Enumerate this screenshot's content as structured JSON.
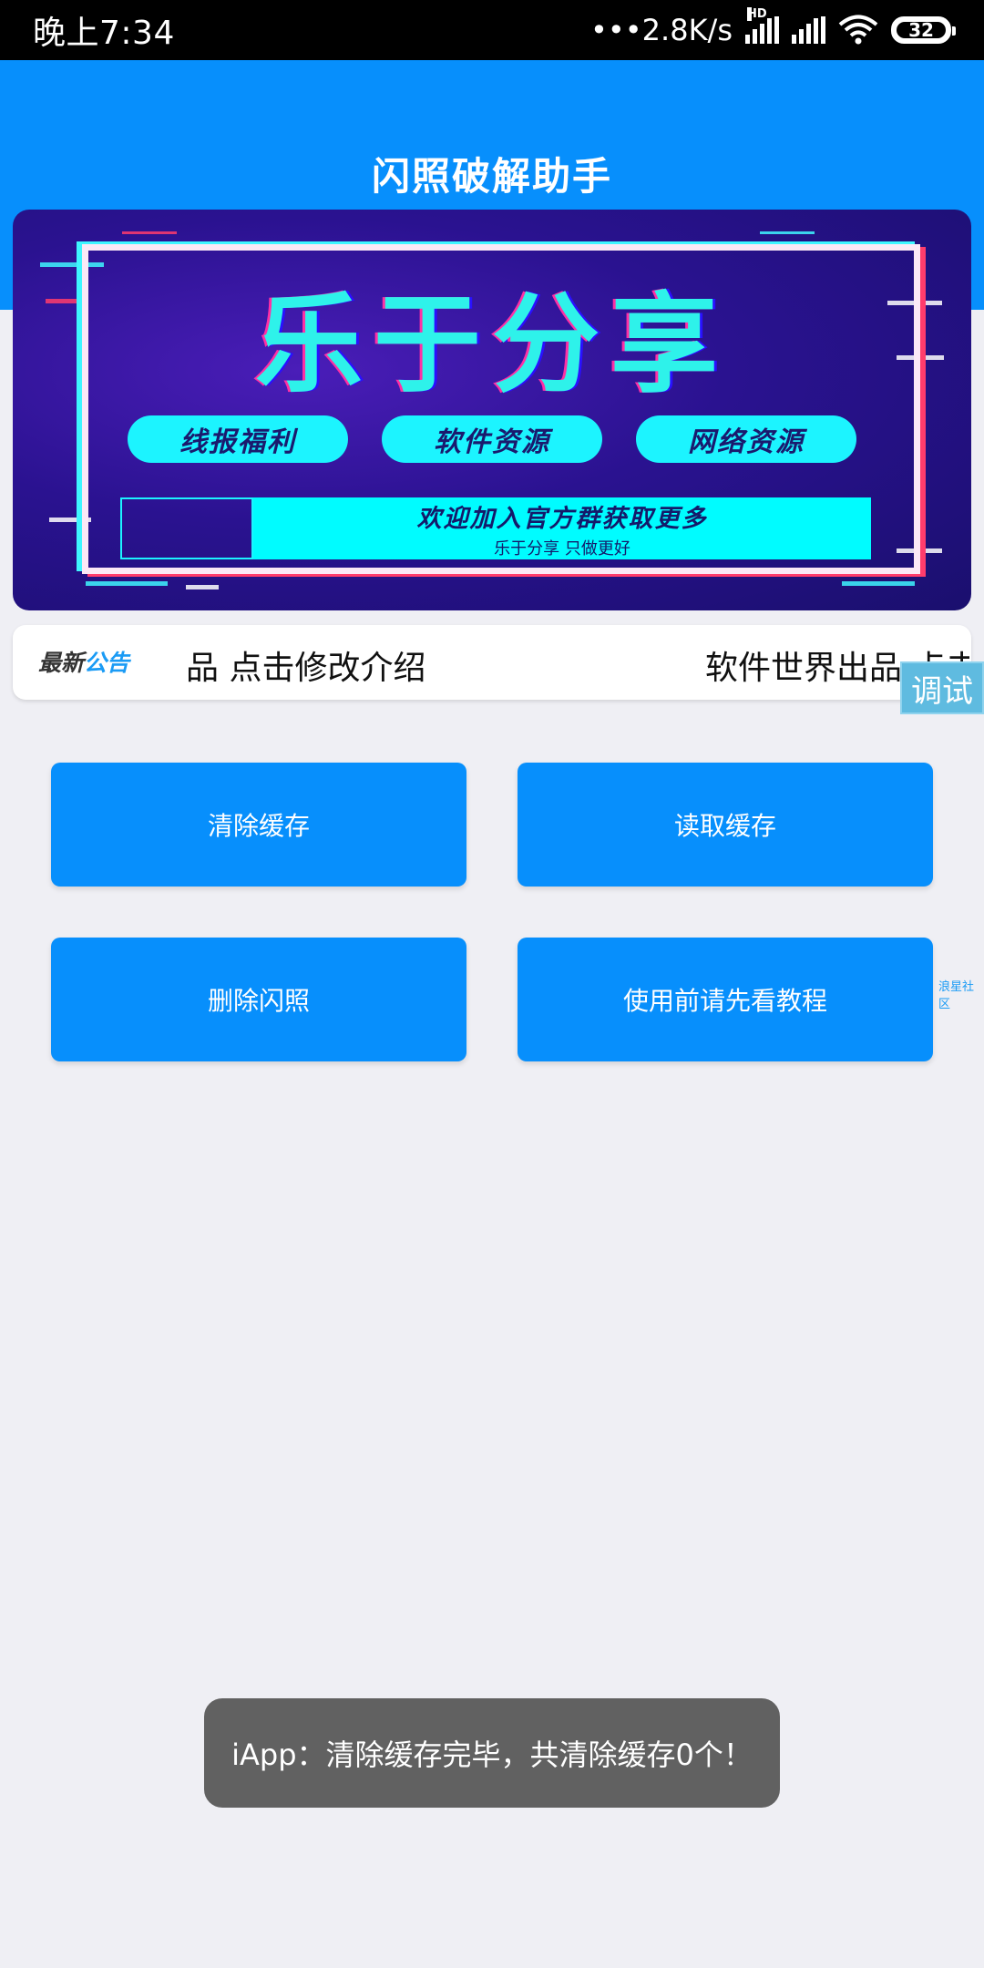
{
  "status_bar": {
    "time": "晚上7:34",
    "network_speed": "•••2.8K/s",
    "hd_label": "HD",
    "battery_level": "32",
    "icons": [
      "signal-icon",
      "signal-icon",
      "wifi-icon",
      "battery-icon"
    ]
  },
  "header": {
    "title": "闪照破解助手",
    "background_color": "#078ffc"
  },
  "banner": {
    "headline": "乐于分享",
    "pills": [
      "线报福利",
      "软件资源",
      "网络资源"
    ],
    "join_main": "欢迎加入官方群获取更多",
    "join_sub": "乐于分享 只做更好"
  },
  "notice": {
    "label_part1": "最新",
    "label_part2": "公告",
    "text_1": "品 点击修改介绍",
    "text_2": "软件世界出品 点击"
  },
  "debug_label": "调试",
  "buttons": {
    "clear_cache": "清除缓存",
    "read_cache": "读取缓存",
    "delete_flash": "删除闪照",
    "tutorial": "使用前请先看教程"
  },
  "side_label": "浪星社区",
  "toast": {
    "message": "iApp：清除缓存完毕，共清除缓存0个！"
  }
}
